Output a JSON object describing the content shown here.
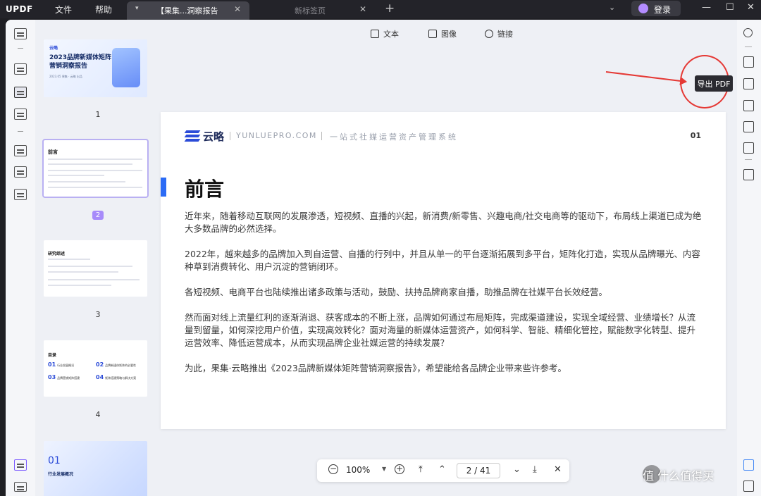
{
  "app": {
    "logo_text": "UPDF",
    "menu": [
      "文件",
      "帮助"
    ],
    "tabs": [
      {
        "title": "【果集...洞察报告",
        "active": true
      },
      {
        "title": "新标签页",
        "active": false
      }
    ],
    "login_label": "登录"
  },
  "toolbar": {
    "text": "文本",
    "image": "图像",
    "link": "链接"
  },
  "tooltip": "导出 PDF",
  "thumbnails": {
    "pages": [
      "1",
      "2",
      "3",
      "4"
    ],
    "selected": "2",
    "t1": {
      "brand": "云略",
      "title_line1": "2023品牌新媒体矩阵",
      "title_line2": "营销洞察报告",
      "meta": "2023.05 果集 · 云略 出品"
    },
    "t2": {
      "heading": "前言"
    },
    "t3": {
      "heading": "研究综述"
    },
    "t4": {
      "heading": "目录",
      "items": [
        {
          "n": "01",
          "label": "行业发展概况"
        },
        {
          "n": "02",
          "label": "品牌新媒体矩阵的必要性"
        },
        {
          "n": "03",
          "label": "品牌营销矩阵搭建"
        },
        {
          "n": "04",
          "label": "矩阵搭建策略与解决方案"
        }
      ]
    },
    "t5": {
      "number": "01",
      "subtitle": "行业发展概况"
    }
  },
  "page": {
    "brand": "云略",
    "site": "YUNLUEPRO.COM",
    "system": "一站式社媒运营资产管理系统",
    "page_number": "01",
    "heading": "前言",
    "paragraphs": [
      "近年来，随着移动互联网的发展渗透，短视频、直播的兴起，新消费/新零售、兴趣电商/社交电商等的驱动下，布局线上渠道已成为绝大多数品牌的必然选择。",
      "2022年，越来越多的品牌加入到自运营、自播的行列中，并且从单一的平台逐渐拓展到多平台，矩阵化打造，实现从品牌曝光、内容种草到消费转化、用户沉淀的营销闭环。",
      "各短视频、电商平台也陆续推出诸多政策与活动，鼓励、扶持品牌商家自播，助推品牌在社媒平台长效经营。",
      "然而面对线上流量红利的逐渐消退、获客成本的不断上涨，品牌如何通过布局矩阵，完成渠道建设，实现全域经营、业绩增长？从流量到留量，如何深挖用户价值，实现高效转化？面对海量的新媒体运营资产，如何科学、智能、精细化管控，赋能数字化转型、提升运营效率、降低运营成本，从而实现品牌企业社媒运营的持续发展？",
      "为此，果集·云略推出《2023品牌新媒体矩阵营销洞察报告》，希望能给各品牌企业带来些许参考。"
    ]
  },
  "nav": {
    "zoom": "100%",
    "page_input": "2 / 41"
  },
  "watermark": "值 什么值得买",
  "colors": {
    "accent": "#2b6bf5",
    "annotation": "#e53935",
    "selection": "#a78bfa"
  }
}
